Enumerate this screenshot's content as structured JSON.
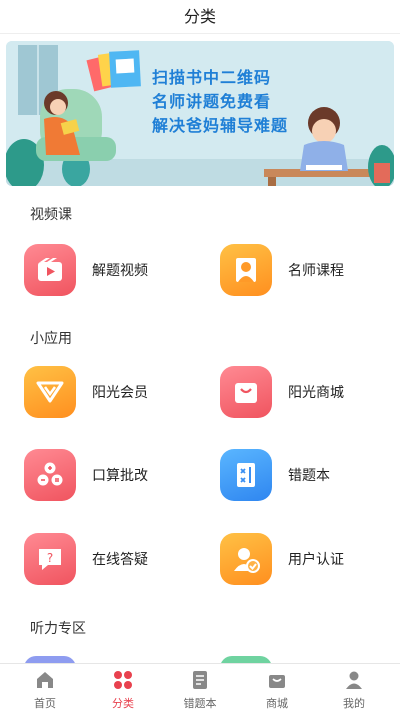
{
  "header": {
    "title": "分类"
  },
  "banner": {
    "lines": [
      "扫描书中二维码",
      "名师讲题免费看",
      "解决爸妈辅导难题"
    ]
  },
  "sections": [
    {
      "title": "视频课",
      "items": [
        {
          "label": "解题视频",
          "icon": "video-play-icon",
          "color": "pink"
        },
        {
          "label": "名师课程",
          "icon": "teacher-icon",
          "color": "orange"
        }
      ]
    },
    {
      "title": "小应用",
      "items": [
        {
          "label": "阳光会员",
          "icon": "vip-diamond-icon",
          "color": "orange"
        },
        {
          "label": "阳光商城",
          "icon": "shopping-bag-icon",
          "color": "pink"
        },
        {
          "label": "口算批改",
          "icon": "calculator-icon",
          "color": "pink"
        },
        {
          "label": "错题本",
          "icon": "notebook-icon",
          "color": "blue"
        },
        {
          "label": "在线答疑",
          "icon": "question-chat-icon",
          "color": "pink"
        },
        {
          "label": "用户认证",
          "icon": "user-verified-icon",
          "color": "orange"
        }
      ]
    },
    {
      "title": "听力专区",
      "items": []
    }
  ],
  "tabbar": {
    "items": [
      {
        "label": "首页",
        "icon": "home-icon",
        "active": false
      },
      {
        "label": "分类",
        "icon": "category-grid-icon",
        "active": true
      },
      {
        "label": "错题本",
        "icon": "notebook-icon",
        "active": false
      },
      {
        "label": "商城",
        "icon": "shop-icon",
        "active": false
      },
      {
        "label": "我的",
        "icon": "profile-icon",
        "active": false
      }
    ]
  },
  "colors": {
    "accent": "#e8414e",
    "pink": "#f0545f",
    "orange": "#ff9a28",
    "blue": "#3a8ff2"
  }
}
